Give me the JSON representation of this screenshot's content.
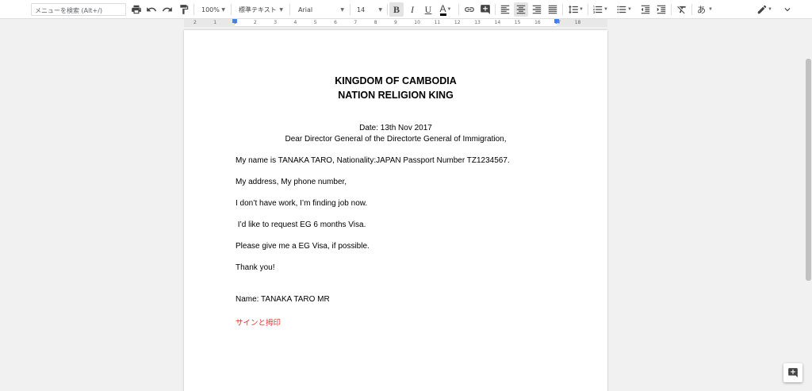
{
  "toolbar": {
    "search_placeholder": "メニューを検索 (Alt+/)",
    "zoom": "100%",
    "style": "標準テキスト",
    "font": "Arial",
    "font_size": "14",
    "bold_label": "B",
    "italic_label": "I",
    "underline_label": "U",
    "text_color_label": "A",
    "input_tool_label": "あ"
  },
  "ruler": {
    "numbers": [
      "2",
      "1",
      "1",
      "2",
      "3",
      "4",
      "5",
      "6",
      "7",
      "8",
      "9",
      "10",
      "11",
      "12",
      "13",
      "14",
      "15",
      "16",
      "17",
      "18"
    ]
  },
  "document": {
    "title_line1": "KINGDOM OF CAMBODIA",
    "title_line2": "NATION RELIGION KING",
    "date": "Date: 13th Nov 2017",
    "salutation": "Dear Director General of the Directorte General of Immigration,",
    "p1": "My name is TANAKA TARO, Nationality:JAPAN Passport Number TZ1234567.",
    "p2": "My address, My phone number,",
    "p3": "I don’t have work, I’m finding job now.",
    "p4": " I’d like to request EG 6 months Visa.",
    "p5": "Please give me a EG Visa, if possible.",
    "p6": "Thank you!",
    "p7": "Name: TANAKA TARO MR",
    "p8": "サインと拇印"
  },
  "colors": {
    "accent": "#4285f4",
    "signature_red": "#e0312d"
  }
}
